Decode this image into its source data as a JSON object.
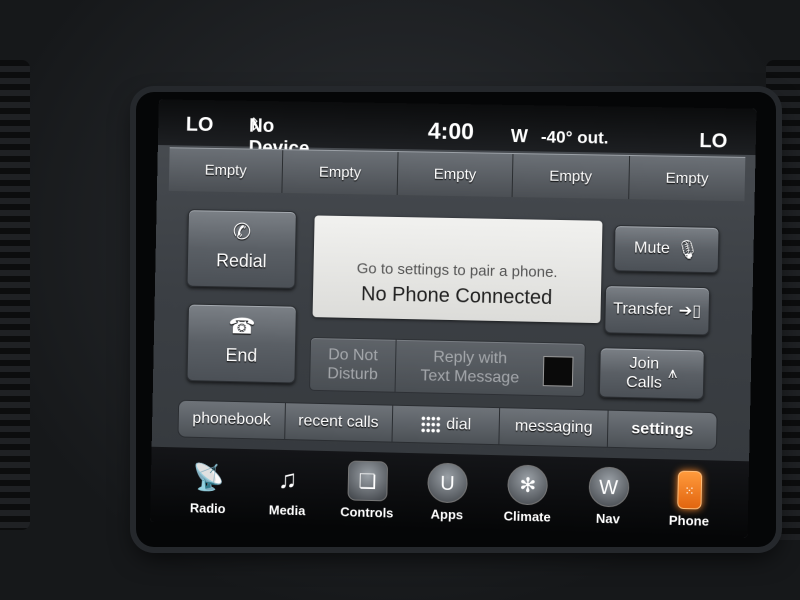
{
  "status": {
    "temp_left": "LO",
    "bluetooth_icon": "bluetooth-icon",
    "device": "No Device",
    "clock": "4:00",
    "compass": "W",
    "outside_temp": "-40° out.",
    "temp_right": "LO"
  },
  "favorites": [
    "Empty",
    "Empty",
    "Empty",
    "Empty",
    "Empty"
  ],
  "phone": {
    "redial_label": "Redial",
    "end_label": "End",
    "message_hint": "Go to settings to pair a phone.",
    "message_main": "No Phone Connected",
    "dnd_label_1": "Do Not",
    "dnd_label_2": "Disturb",
    "reply_label_1": "Reply with",
    "reply_label_2": "Text Message",
    "mute_label": "Mute",
    "transfer_label": "Transfer",
    "join_label_1": "Join",
    "join_label_2": "Calls"
  },
  "tabs": [
    "phonebook",
    "recent calls",
    "dial",
    "messaging",
    "settings"
  ],
  "nav": [
    {
      "label": "Radio",
      "icon": "radio-tower-icon"
    },
    {
      "label": "Media",
      "icon": "media-player-icon"
    },
    {
      "label": "Controls",
      "icon": "controls-seat-icon"
    },
    {
      "label": "Apps",
      "icon": "apps-icon"
    },
    {
      "label": "Climate",
      "icon": "climate-fan-icon"
    },
    {
      "label": "Nav",
      "icon": "compass-nav-icon"
    },
    {
      "label": "Phone",
      "icon": "phone-icon"
    }
  ],
  "colors": {
    "screen": "#3b3f44",
    "message_box": "#e9e9e6",
    "phone_active": "#e2650f"
  }
}
